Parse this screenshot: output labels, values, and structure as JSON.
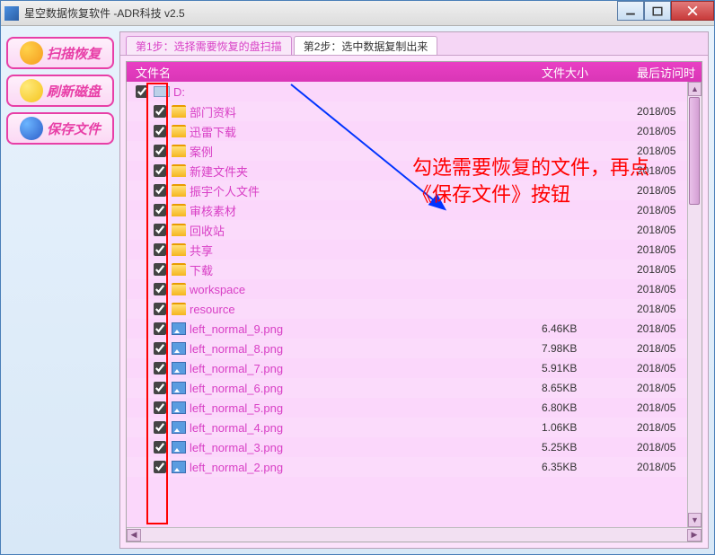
{
  "window": {
    "title": "星空数据恢复软件   -ADR科技 v2.5"
  },
  "sidebar": {
    "scan": "扫描恢复",
    "refresh": "刷新磁盘",
    "save": "保存文件"
  },
  "tabs": {
    "step1": "第1步：选择需要恢复的盘扫描",
    "step2": "第2步：选中数据复制出来"
  },
  "columns": {
    "name": "文件名",
    "size": "文件大小",
    "time": "最后访问时"
  },
  "rootLabel": "D:",
  "files": [
    {
      "type": "folder",
      "name": "部门资料",
      "size": "",
      "time": "2018/05"
    },
    {
      "type": "folder",
      "name": "迅雷下载",
      "size": "",
      "time": "2018/05"
    },
    {
      "type": "folder",
      "name": "案例",
      "size": "",
      "time": "2018/05"
    },
    {
      "type": "folder",
      "name": "新建文件夹",
      "size": "",
      "time": "2018/05"
    },
    {
      "type": "folder",
      "name": "振宇个人文件",
      "size": "",
      "time": "2018/05"
    },
    {
      "type": "folder",
      "name": "审核素材",
      "size": "",
      "time": "2018/05"
    },
    {
      "type": "folder",
      "name": "回收站",
      "size": "",
      "time": "2018/05"
    },
    {
      "type": "folder",
      "name": "共享",
      "size": "",
      "time": "2018/05"
    },
    {
      "type": "folder",
      "name": "下载",
      "size": "",
      "time": "2018/05"
    },
    {
      "type": "folder",
      "name": "workspace",
      "size": "",
      "time": "2018/05"
    },
    {
      "type": "folder",
      "name": "resource",
      "size": "",
      "time": "2018/05"
    },
    {
      "type": "png",
      "name": "left_normal_9.png",
      "size": "6.46KB",
      "time": "2018/05"
    },
    {
      "type": "png",
      "name": "left_normal_8.png",
      "size": "7.98KB",
      "time": "2018/05"
    },
    {
      "type": "png",
      "name": "left_normal_7.png",
      "size": "5.91KB",
      "time": "2018/05"
    },
    {
      "type": "png",
      "name": "left_normal_6.png",
      "size": "8.65KB",
      "time": "2018/05"
    },
    {
      "type": "png",
      "name": "left_normal_5.png",
      "size": "6.80KB",
      "time": "2018/05"
    },
    {
      "type": "png",
      "name": "left_normal_4.png",
      "size": "1.06KB",
      "time": "2018/05"
    },
    {
      "type": "png",
      "name": "left_normal_3.png",
      "size": "5.25KB",
      "time": "2018/05"
    },
    {
      "type": "png",
      "name": "left_normal_2.png",
      "size": "6.35KB",
      "time": "2018/05"
    }
  ],
  "annotation": {
    "line1": "勾选需要恢复的文件，再点",
    "line2": "《保存文件》按钮"
  }
}
